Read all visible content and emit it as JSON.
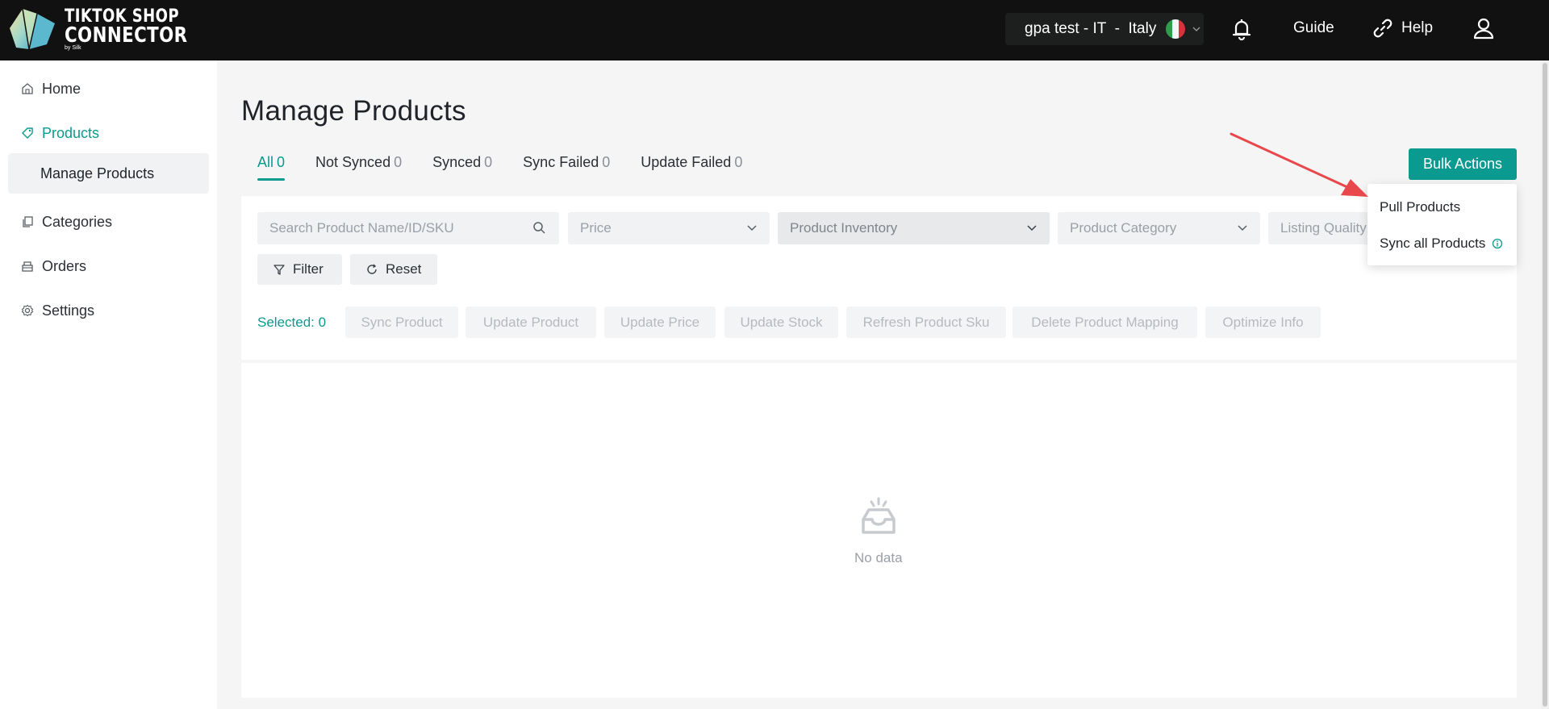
{
  "header": {
    "logo_line1": "TIKTOK SHOP",
    "logo_line2": "CONNECTOR",
    "logo_line3": "by Silk",
    "store_label": "gpa test - IT  -  Italy",
    "guide_label": "Guide",
    "help_label": "Help"
  },
  "sidebar": {
    "items": [
      {
        "label": "Home",
        "icon": "home-icon"
      },
      {
        "label": "Products",
        "icon": "tag-icon"
      },
      {
        "label": "Categories",
        "icon": "copy-icon"
      },
      {
        "label": "Orders",
        "icon": "box-icon"
      },
      {
        "label": "Settings",
        "icon": "gear-icon"
      }
    ],
    "sub_item": "Manage Products"
  },
  "main": {
    "title": "Manage Products",
    "tabs": [
      {
        "label": "All",
        "count": "0"
      },
      {
        "label": "Not Synced",
        "count": "0"
      },
      {
        "label": "Synced",
        "count": "0"
      },
      {
        "label": "Sync Failed",
        "count": "0"
      },
      {
        "label": "Update Failed",
        "count": "0"
      }
    ],
    "bulk_actions": "Bulk Actions",
    "filters": {
      "search_placeholder": "Search Product Name/ID/SKU",
      "price": "Price",
      "inventory": "Product Inventory",
      "category": "Product Category",
      "listing_quality": "Listing Quality"
    },
    "filter_button": "Filter",
    "reset_button": "Reset",
    "selected": "Selected: 0",
    "actions": [
      "Sync Product",
      "Update Product",
      "Update Price",
      "Update Stock",
      "Refresh Product Sku",
      "Delete Product Mapping",
      "Optimize Info"
    ],
    "empty_text": "No data"
  },
  "dropdown": {
    "items": [
      "Pull Products",
      "Sync all Products"
    ]
  },
  "colors": {
    "accent": "#0a9a8f",
    "header_bg": "#111111",
    "arrow": "#e8484b"
  }
}
